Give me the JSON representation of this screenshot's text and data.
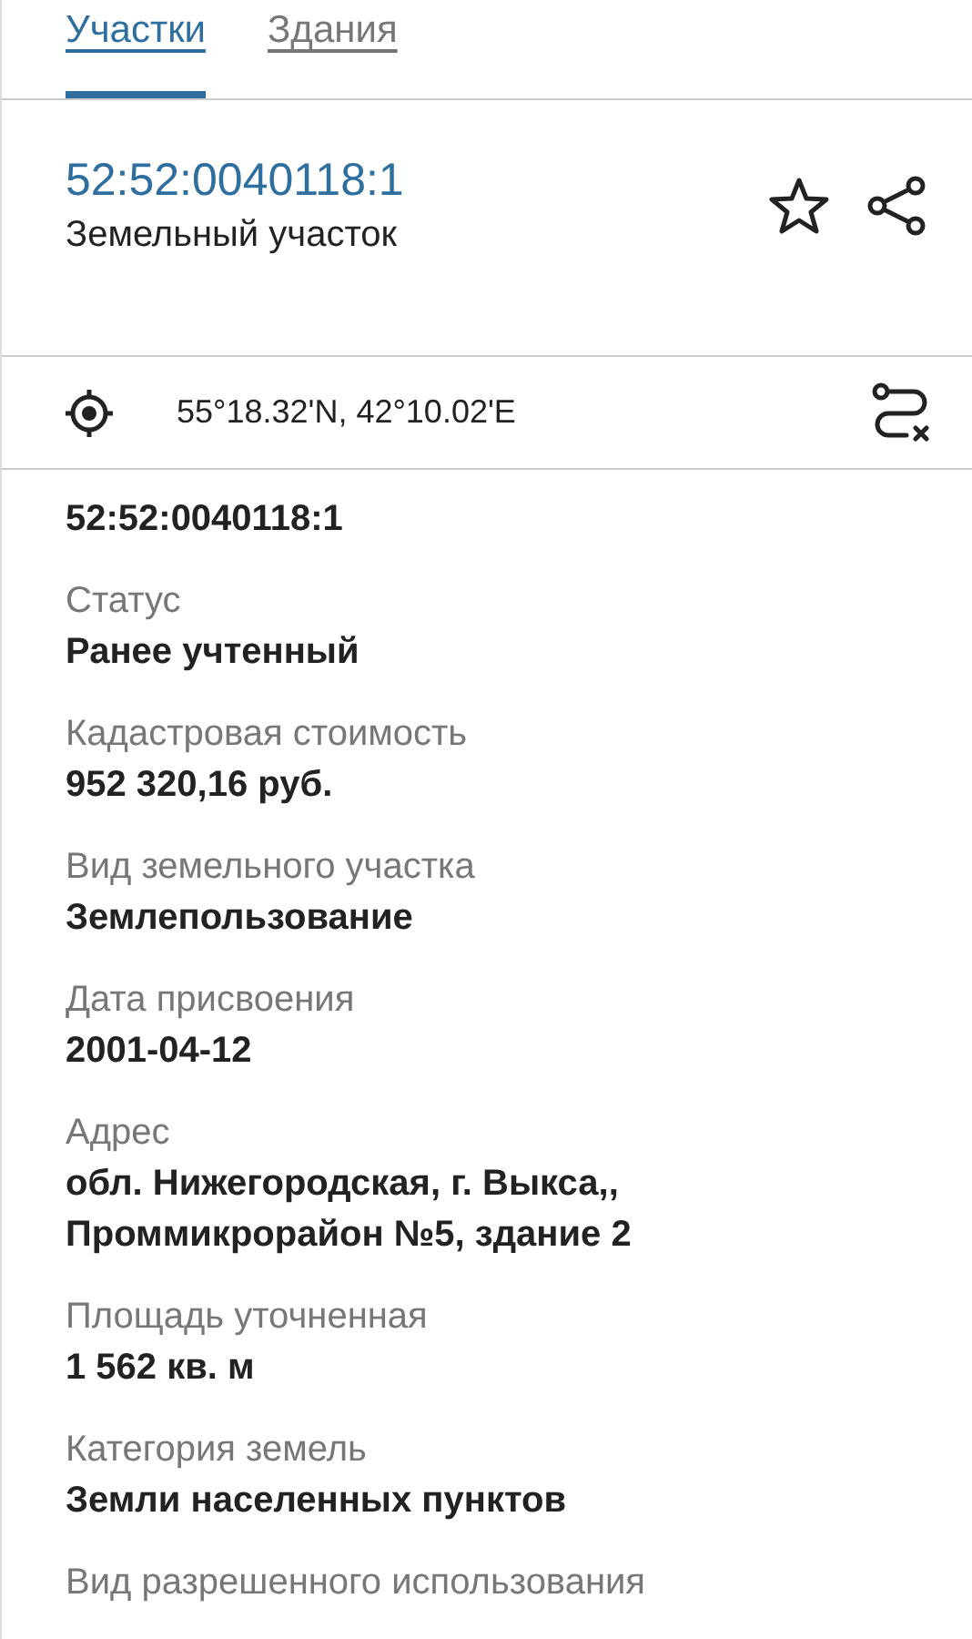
{
  "tabs": [
    {
      "label": "Участки",
      "selected": true
    },
    {
      "label": "Здания",
      "selected": false
    }
  ],
  "header": {
    "cadastral_number": "52:52:0040118:1",
    "type": "Земельный участок"
  },
  "coordinates": "55°18.32'N, 42°10.02'E",
  "fields": [
    {
      "value": "52:52:0040118:1"
    },
    {
      "label": "Статус",
      "value": "Ранее учтенный"
    },
    {
      "label": "Кадастровая стоимость",
      "value": "952 320,16 руб."
    },
    {
      "label": "Вид земельного участка",
      "value": "Землепользование"
    },
    {
      "label": "Дата присвоения",
      "value": "2001-04-12"
    },
    {
      "label": "Адрес",
      "value": "обл. Нижегородская, г. Выкса,, Проммикрорайон №5, здание 2"
    },
    {
      "label": "Площадь уточненная",
      "value": "1 562 кв. м"
    },
    {
      "label": "Категория земель",
      "value": "Земли населенных пунктов"
    },
    {
      "label": "Вид разрешенного использования"
    }
  ]
}
